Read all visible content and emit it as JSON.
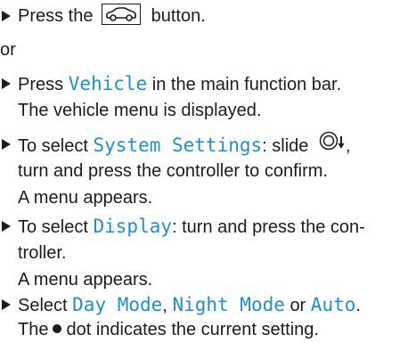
{
  "step1": {
    "pre": "Press the",
    "post": "button.",
    "icon": "car-button-icon"
  },
  "or_text": "or",
  "step2": {
    "pre": "Press",
    "term": "Vehicle",
    "post": "in the main function bar.",
    "line2": "The vehicle menu is displayed."
  },
  "step3": {
    "pre": "To select",
    "term": "System Settings",
    "post": ": slide",
    "line2": "turn and press the controller to confirm.",
    "line3": "A menu appears.",
    "icon": "controller-slide-down-icon"
  },
  "step4": {
    "pre": "To select",
    "term": "Display",
    "post": ": turn and press the con-",
    "line2": "troller.",
    "line3": "A menu appears."
  },
  "step5": {
    "pre": "Select",
    "term1": "Day Mode",
    "sep": ",",
    "term2": "Night Mode",
    "or": "or",
    "term3": "Auto",
    "end": ".",
    "line2_pre": "The",
    "line2_post": "dot indicates the current setting."
  },
  "colors": {
    "accent": "#1f8fcf",
    "text": "#1c1c1c"
  }
}
